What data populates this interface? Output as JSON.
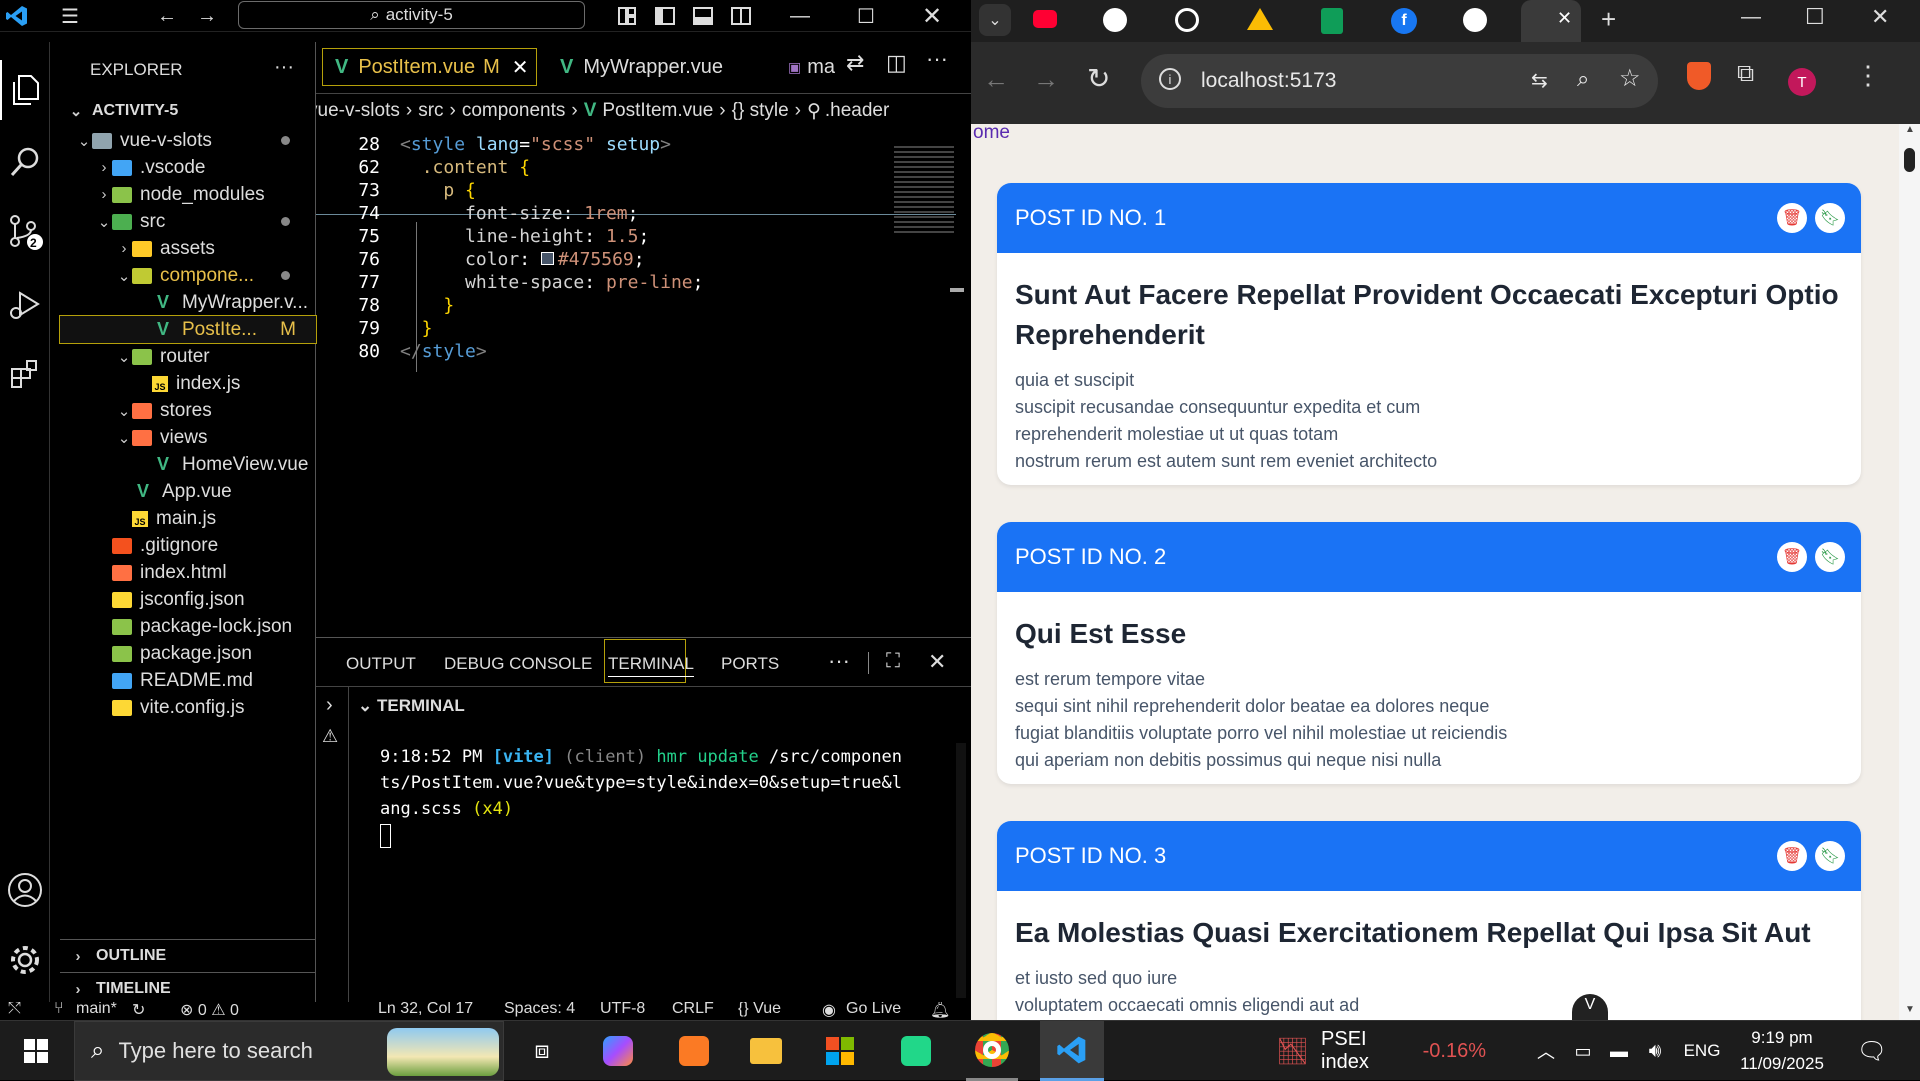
{
  "vscode": {
    "search_text": "activity-5",
    "explorer_title": "EXPLORER",
    "source_control_badge": "2",
    "project_root": "ACTIVITY-5",
    "tree": [
      {
        "label": "vue-v-slots",
        "icon": "folder-icon"
      },
      {
        "label": ".vscode",
        "icon": "folder-vscode-icon"
      },
      {
        "label": "node_modules",
        "icon": "folder-node-icon"
      },
      {
        "label": "src",
        "icon": "folder-src-icon"
      },
      {
        "label": "assets",
        "icon": "folder-assets-icon"
      },
      {
        "label": "compone...",
        "icon": "folder-components-icon"
      },
      {
        "label": "MyWrapper.v...",
        "icon": "vue-file-icon"
      },
      {
        "label": "PostIte...",
        "icon": "vue-file-icon",
        "badge": "M"
      },
      {
        "label": "router",
        "icon": "folder-router-icon"
      },
      {
        "label": "index.js",
        "icon": "js-file-icon"
      },
      {
        "label": "stores",
        "icon": "folder-stores-icon"
      },
      {
        "label": "views",
        "icon": "folder-views-icon"
      },
      {
        "label": "HomeView.vue",
        "icon": "vue-file-icon"
      },
      {
        "label": "App.vue",
        "icon": "vue-file-icon"
      },
      {
        "label": "main.js",
        "icon": "js-file-icon"
      },
      {
        "label": ".gitignore",
        "icon": "git-icon"
      },
      {
        "label": "index.html",
        "icon": "html-file-icon"
      },
      {
        "label": "jsconfig.json",
        "icon": "json-file-icon"
      },
      {
        "label": "package-lock.json",
        "icon": "npm-icon"
      },
      {
        "label": "package.json",
        "icon": "npm-icon"
      },
      {
        "label": "README.md",
        "icon": "info-icon"
      },
      {
        "label": "vite.config.js",
        "icon": "vite-icon"
      }
    ],
    "outline_label": "OUTLINE",
    "timeline_label": "TIMELINE",
    "tabs": [
      {
        "label": "PostItem.vue",
        "badge": "M"
      },
      {
        "label": "MyWrapper.vue"
      },
      {
        "label": "ma"
      }
    ],
    "breadcrumb": [
      "vue-v-slots",
      "src",
      "components",
      "PostItem.vue",
      "{} style",
      ".header"
    ],
    "code_lines": [
      {
        "num": "28",
        "text": "<style lang=\"scss\" setup>"
      },
      {
        "num": "62",
        "text": "  .content {"
      },
      {
        "num": "73",
        "text": "    p {"
      },
      {
        "num": "74",
        "text": "      font-size: 1rem;"
      },
      {
        "num": "75",
        "text": "      line-height: 1.5;"
      },
      {
        "num": "76",
        "text": "      color: #475569;"
      },
      {
        "num": "77",
        "text": "      white-space: pre-line;"
      },
      {
        "num": "78",
        "text": "    }"
      },
      {
        "num": "79",
        "text": "  }"
      },
      {
        "num": "80",
        "text": "</style>"
      }
    ],
    "panel_tabs": [
      "OUTPUT",
      "DEBUG CONSOLE",
      "TERMINAL",
      "PORTS"
    ],
    "terminal_title": "TERMINAL",
    "terminal_line1": "9:18:52 PM [vite] (client) hmr update /src/componen",
    "terminal_line2": "ts/PostItem.vue?vue&type=style&index=0&setup=true&l",
    "terminal_line3": "ang.scss (x4)",
    "status": {
      "branch": "main*",
      "problems": "⊗ 0 ⚠ 0",
      "position": "Ln 32, Col 17",
      "spaces": "Spaces: 4",
      "encoding": "UTF-8",
      "eol": "CRLF",
      "language": "{} Vue",
      "golive": "Go Live"
    }
  },
  "browser": {
    "url": "localhost:5173",
    "profile_initial": "T",
    "nav_link": "ome",
    "posts": [
      {
        "header": "POST ID NO. 1",
        "title": "Sunt Aut Facere Repellat Provident Occaecati Excepturi Optio Reprehenderit",
        "body": "quia et suscipit\nsuscipit recusandae consequuntur expedita et cum\nreprehenderit molestiae ut ut quas totam\nnostrum rerum est autem sunt rem eveniet architecto"
      },
      {
        "header": "POST ID NO. 2",
        "title": "Qui Est Esse",
        "body": "est rerum tempore vitae\nsequi sint nihil reprehenderit dolor beatae ea dolores neque\nfugiat blanditiis voluptate porro vel nihil molestiae ut reiciendis\nqui aperiam non debitis possimus qui neque nisi nulla"
      },
      {
        "header": "POST ID NO. 3",
        "title": "Ea Molestias Quasi Exercitationem Repellat Qui Ipsa Sit Aut",
        "body": "et iusto sed quo iure\nvoluptatem occaecati omnis eligendi aut ad"
      }
    ]
  },
  "taskbar": {
    "search_placeholder": "Type here to search",
    "stock_label": "PSEI index",
    "stock_change": "-0.16%",
    "language": "ENG",
    "time": "9:19 pm",
    "date": "11/09/2025"
  },
  "colors": {
    "accent_blue": "#1a73f5",
    "text_slate": "#475569",
    "title_dark": "#1e2633",
    "stock_red": "#e05252"
  }
}
